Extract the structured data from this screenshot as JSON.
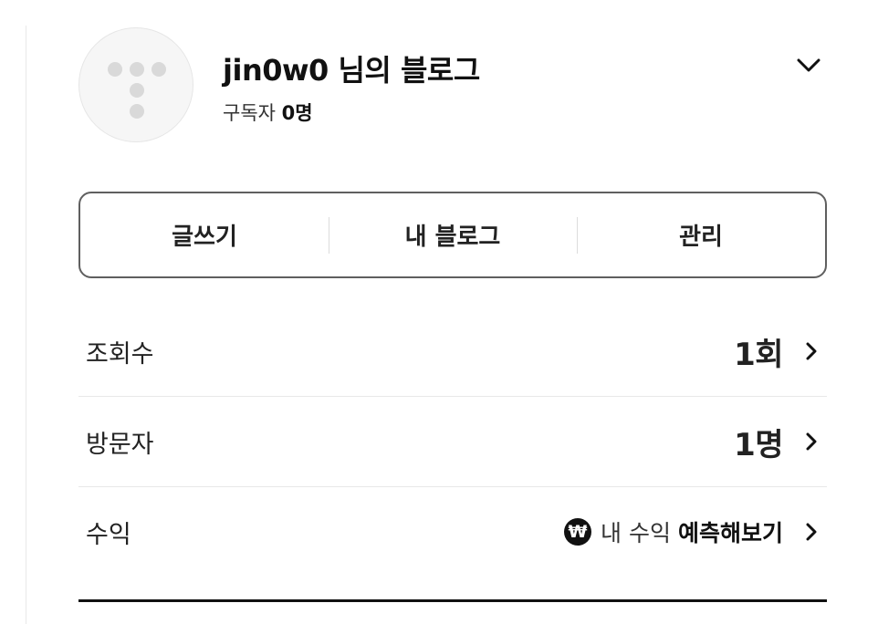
{
  "profile": {
    "blog_title": "jin0w0 님의 블로그",
    "subscribers_label": "구독자",
    "subscribers_count": "0명",
    "avatar_icon": "tistory-logo-icon",
    "toggle_icon": "chevron-down-icon"
  },
  "actions": [
    {
      "label": "글쓰기"
    },
    {
      "label": "내 블로그"
    },
    {
      "label": "관리"
    }
  ],
  "stats": {
    "views": {
      "label": "조회수",
      "value": "1회"
    },
    "visitors": {
      "label": "방문자",
      "value": "1명"
    },
    "revenue": {
      "label": "수익",
      "won_symbol": "₩",
      "link_plain": "내 수익",
      "link_strong": "예측해보기"
    }
  },
  "colors": {
    "text": "#111111",
    "border": "#5f5f5f",
    "divider": "#e8e8e8",
    "avatar_dot": "#d9d9d9"
  }
}
